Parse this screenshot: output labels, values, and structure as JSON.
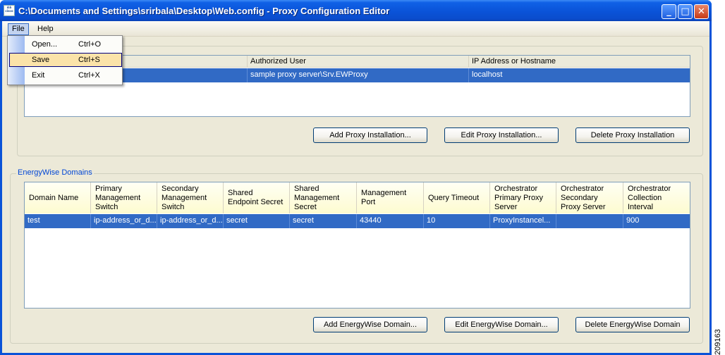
{
  "window": {
    "title": "C:\\Documents and Settings\\srirbala\\Desktop\\Web.config - Proxy Configuration Editor",
    "app_icon": "cisco-logo-icon",
    "minimize_glyph": "_",
    "maximize_glyph": "□",
    "close_glyph": "✕"
  },
  "menubar": {
    "file": "File",
    "help": "Help"
  },
  "file_menu": {
    "items": [
      {
        "label": "Open...",
        "shortcut": "Ctrl+O"
      },
      {
        "label": "Save",
        "shortcut": "Ctrl+S"
      },
      {
        "label": "Exit",
        "shortcut": "Ctrl+X"
      }
    ]
  },
  "proxy_installations": {
    "columns": [
      "",
      "Authorized User",
      "IP Address or Hostname"
    ],
    "rows": [
      [
        "",
        "sample proxy server\\Srv.EWProxy",
        "localhost"
      ]
    ],
    "buttons": {
      "add": "Add Proxy Installation...",
      "edit": "Edit Proxy Installation...",
      "delete": "Delete Proxy Installation"
    }
  },
  "energywise_domains": {
    "group_label": "EnergyWise Domains",
    "columns": [
      "Domain Name",
      "Primary Management Switch",
      "Secondary Management Switch",
      "Shared Endpoint Secret",
      "Shared Management Secret",
      "Management Port",
      "Query Timeout",
      "Orchestrator Primary Proxy Server",
      "Orchestrator Secondary Proxy Server",
      "Orchestrator Collection Interval"
    ],
    "rows": [
      [
        "test",
        "ip-address_or_d...",
        "ip-address_or_d...",
        "secret",
        "secret",
        "43440",
        "10",
        "ProxyInstancel...",
        "",
        "900"
      ]
    ],
    "buttons": {
      "add": "Add EnergyWise Domain...",
      "edit": "Edit EnergyWise Domain...",
      "delete": "Delete EnergyWise Domain"
    }
  },
  "figure_number": "209163",
  "colors": {
    "selection": "#316ac5",
    "title_bar": "#0a53d8",
    "group_label": "#0046d5",
    "menu_highlight": "#fbe3a9"
  }
}
